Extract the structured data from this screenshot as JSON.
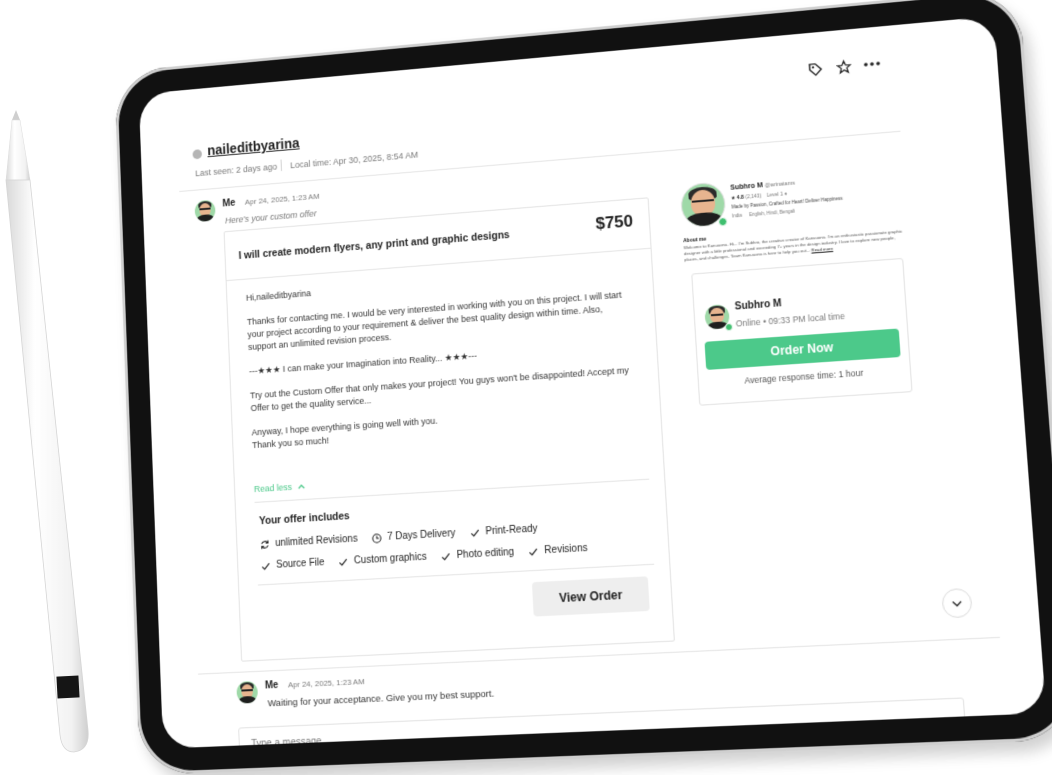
{
  "header": {
    "username": "naileditbyarina",
    "last_seen": "Last seen: 2 days ago",
    "local_time": "Local time: Apr 30, 2025, 8:54 AM"
  },
  "toolbar_icons": [
    "tag-icon",
    "star-icon",
    "more-icon"
  ],
  "message1": {
    "sender": "Me",
    "timestamp": "Apr 24, 2025, 1:23 AM",
    "subtitle": "Here's your custom offer"
  },
  "offer": {
    "title": "I will create modern flyers, any print and graphic designs",
    "price": "$750",
    "greeting": "Hi,naileditbyarina",
    "p1": "Thanks for contacting me. I would be very interested in working with you on this project. I will start your project according to your requirement & deliver the best quality design within time. Also, support an unlimited revision process.",
    "p2": "---★★★ I can make your Imagination into Reality... ★★★---",
    "p3": "Try out the Custom Offer that only makes your project! You guys won't be disappointed! Accept my Offer to get the quality service...",
    "p4a": "Anyway, I hope everything is going well with you.",
    "p4b": "Thank you so much!",
    "read_less": "Read less",
    "includes_title": "Your offer includes",
    "includes_row1": [
      "unlimited Revisions",
      "7 Days Delivery",
      "Print-Ready"
    ],
    "includes_row2": [
      "Source File",
      "Custom graphics",
      "Photo editing",
      "Revisions"
    ],
    "view_order": "View Order"
  },
  "profile": {
    "name": "Subhro M",
    "handle": "@arinatams",
    "rating": "★ 4.8",
    "reviews": "(2,143)",
    "level": "Level 1 ♦",
    "tagline": "Made by Passion, Crafted for Heart! Deliver Happiness",
    "country": "India",
    "languages": "English, Hindi, Bengali",
    "about_title": "About me",
    "about_text": "Welcome to Kanuuona. Hi... I'm Subhro, the creative creator of Kanuuona. I'm an enthusiastic passionate graphic designer with a little professional and exceeding 7+ years in the design industry. I love to explore new people, places, and challenges. Team Kanuuona is here to help you out...",
    "read_more": "Read more"
  },
  "order_card": {
    "name": "Subhro M",
    "status": "Online • 09:33 PM local time",
    "order_button": "Order Now",
    "response": "Average response time: 1 hour"
  },
  "message2": {
    "sender": "Me",
    "timestamp": "Apr 24, 2025, 1:23 AM",
    "text": "Waiting for your acceptance. Give you my best support."
  },
  "composer": {
    "placeholder": "Type a message..."
  },
  "colors": {
    "accent": "#4cc98a",
    "online": "#3fbf6f"
  }
}
